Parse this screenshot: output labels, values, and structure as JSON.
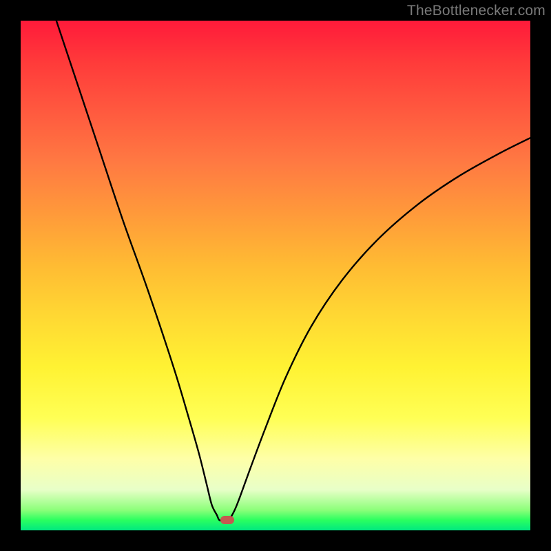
{
  "watermark": "TheBottlenecker.com",
  "chart_data": {
    "type": "line",
    "title": "",
    "xlabel": "",
    "ylabel": "",
    "xlim": [
      0,
      100
    ],
    "ylim": [
      0,
      100
    ],
    "curve_min_x": 39,
    "curve_min_y": 2,
    "curve": [
      {
        "x": 7,
        "y": 100
      },
      {
        "x": 10,
        "y": 91
      },
      {
        "x": 15,
        "y": 76
      },
      {
        "x": 20,
        "y": 61
      },
      {
        "x": 25,
        "y": 47
      },
      {
        "x": 30,
        "y": 32
      },
      {
        "x": 33,
        "y": 22
      },
      {
        "x": 35,
        "y": 15
      },
      {
        "x": 36.5,
        "y": 9
      },
      {
        "x": 37.5,
        "y": 5
      },
      {
        "x": 38.5,
        "y": 3
      },
      {
        "x": 39,
        "y": 2
      },
      {
        "x": 40,
        "y": 2
      },
      {
        "x": 41,
        "y": 2.3
      },
      {
        "x": 42,
        "y": 4
      },
      {
        "x": 43,
        "y": 6.5
      },
      {
        "x": 45,
        "y": 12
      },
      {
        "x": 48,
        "y": 20
      },
      {
        "x": 52,
        "y": 30
      },
      {
        "x": 57,
        "y": 40
      },
      {
        "x": 63,
        "y": 49
      },
      {
        "x": 70,
        "y": 57
      },
      {
        "x": 78,
        "y": 64
      },
      {
        "x": 86,
        "y": 69.5
      },
      {
        "x": 94,
        "y": 74
      },
      {
        "x": 100,
        "y": 77
      }
    ],
    "marker": {
      "x": 40.5,
      "y": 2
    },
    "background": "rainbow-vertical-red-to-green"
  }
}
